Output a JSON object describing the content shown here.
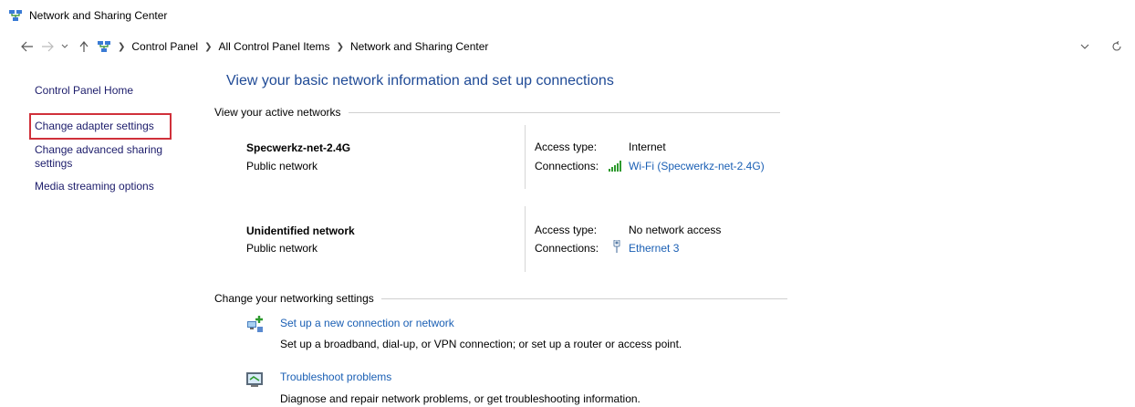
{
  "window": {
    "title": "Network and Sharing Center"
  },
  "address": {
    "breadcrumbs": [
      "Control Panel",
      "All Control Panel Items",
      "Network and Sharing Center"
    ]
  },
  "sidebar": {
    "items": [
      {
        "label": "Control Panel Home"
      },
      {
        "label": "Change adapter settings"
      },
      {
        "label": "Change advanced sharing"
      },
      {
        "label": "settings"
      },
      {
        "label": "Media streaming options"
      }
    ]
  },
  "main": {
    "heading": "View your basic network information and set up connections",
    "active_networks_label": "View your active networks",
    "networks": [
      {
        "name": "Specwerkz-net-2.4G",
        "type": "Public network",
        "access_label": "Access type:",
        "access_value": "Internet",
        "connections_label": "Connections:",
        "connection": "Wi-Fi (Specwerkz-net-2.4G)"
      },
      {
        "name": "Unidentified network",
        "type": "Public network",
        "access_label": "Access type:",
        "access_value": "No network access",
        "connections_label": "Connections:",
        "connection": "Ethernet 3"
      }
    ],
    "settings_label": "Change your networking settings",
    "tasks": [
      {
        "title": "Set up a new connection or network",
        "desc": "Set up a broadband, dial-up, or VPN connection; or set up a router or access point."
      },
      {
        "title": "Troubleshoot problems",
        "desc": "Diagnose and repair network problems, or get troubleshooting information."
      }
    ]
  },
  "colors": {
    "link": "#1a5fb4",
    "heading": "#1f4a96",
    "highlight": "#d0303a"
  }
}
